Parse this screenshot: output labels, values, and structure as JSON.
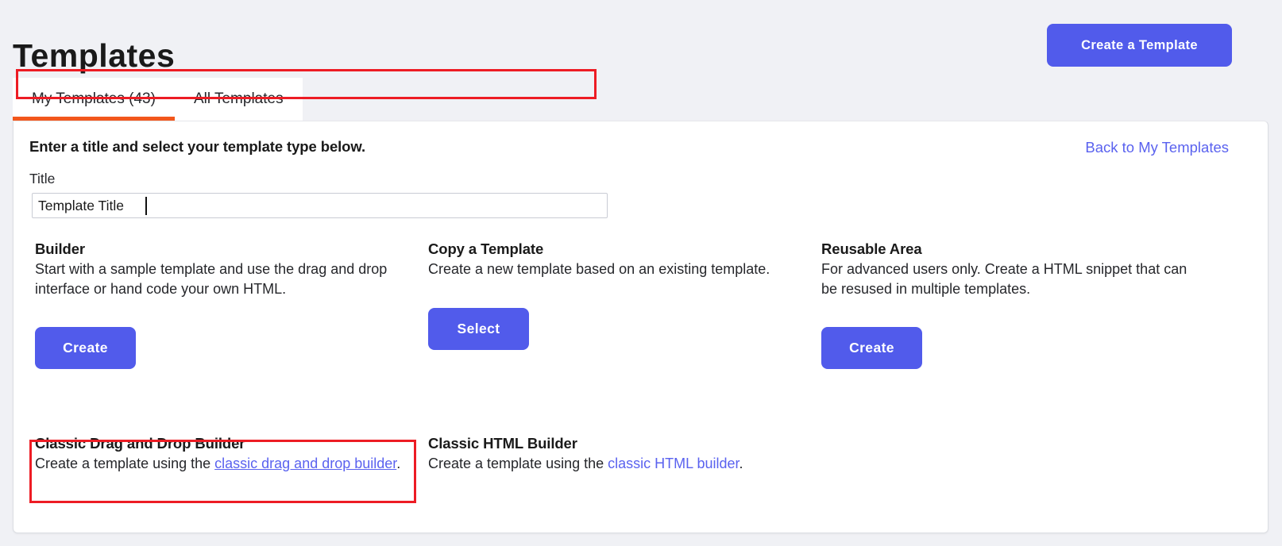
{
  "header": {
    "title": "Templates",
    "cta_label": "Create a Template"
  },
  "tabs": [
    {
      "label": "My Templates (43)",
      "active": true
    },
    {
      "label": "All Templates",
      "active": false
    }
  ],
  "card": {
    "heading": "Enter a title and select your template type below.",
    "back_link": "Back to My Templates",
    "title_field": {
      "label": "Title",
      "value": "Template Title",
      "placeholder": "Template Title"
    },
    "options": [
      {
        "title": "Builder",
        "description": "Start with a sample template and use the drag and drop interface or hand code your own HTML.",
        "button": "Create"
      },
      {
        "title": "Copy a Template",
        "description": "Create a new template based on an existing template.",
        "button": "Select"
      },
      {
        "title": "Reusable Area",
        "description": "For advanced users only. Create a HTML snippet that can be resused in multiple templates.",
        "button": "Create"
      }
    ],
    "classics": [
      {
        "title": "Classic Drag and Drop Builder",
        "text_before": "Create a template using the ",
        "link": "classic drag and drop builder",
        "text_after": "."
      },
      {
        "title": "Classic HTML Builder",
        "text_before": "Create a template using the ",
        "link": "classic HTML builder",
        "text_after": "."
      }
    ]
  },
  "colors": {
    "accent_primary": "#515beb",
    "accent_tab": "#f2571c",
    "link": "#5a62ef",
    "annotation": "#ed1c24",
    "page_background": "#f0f1f5"
  }
}
